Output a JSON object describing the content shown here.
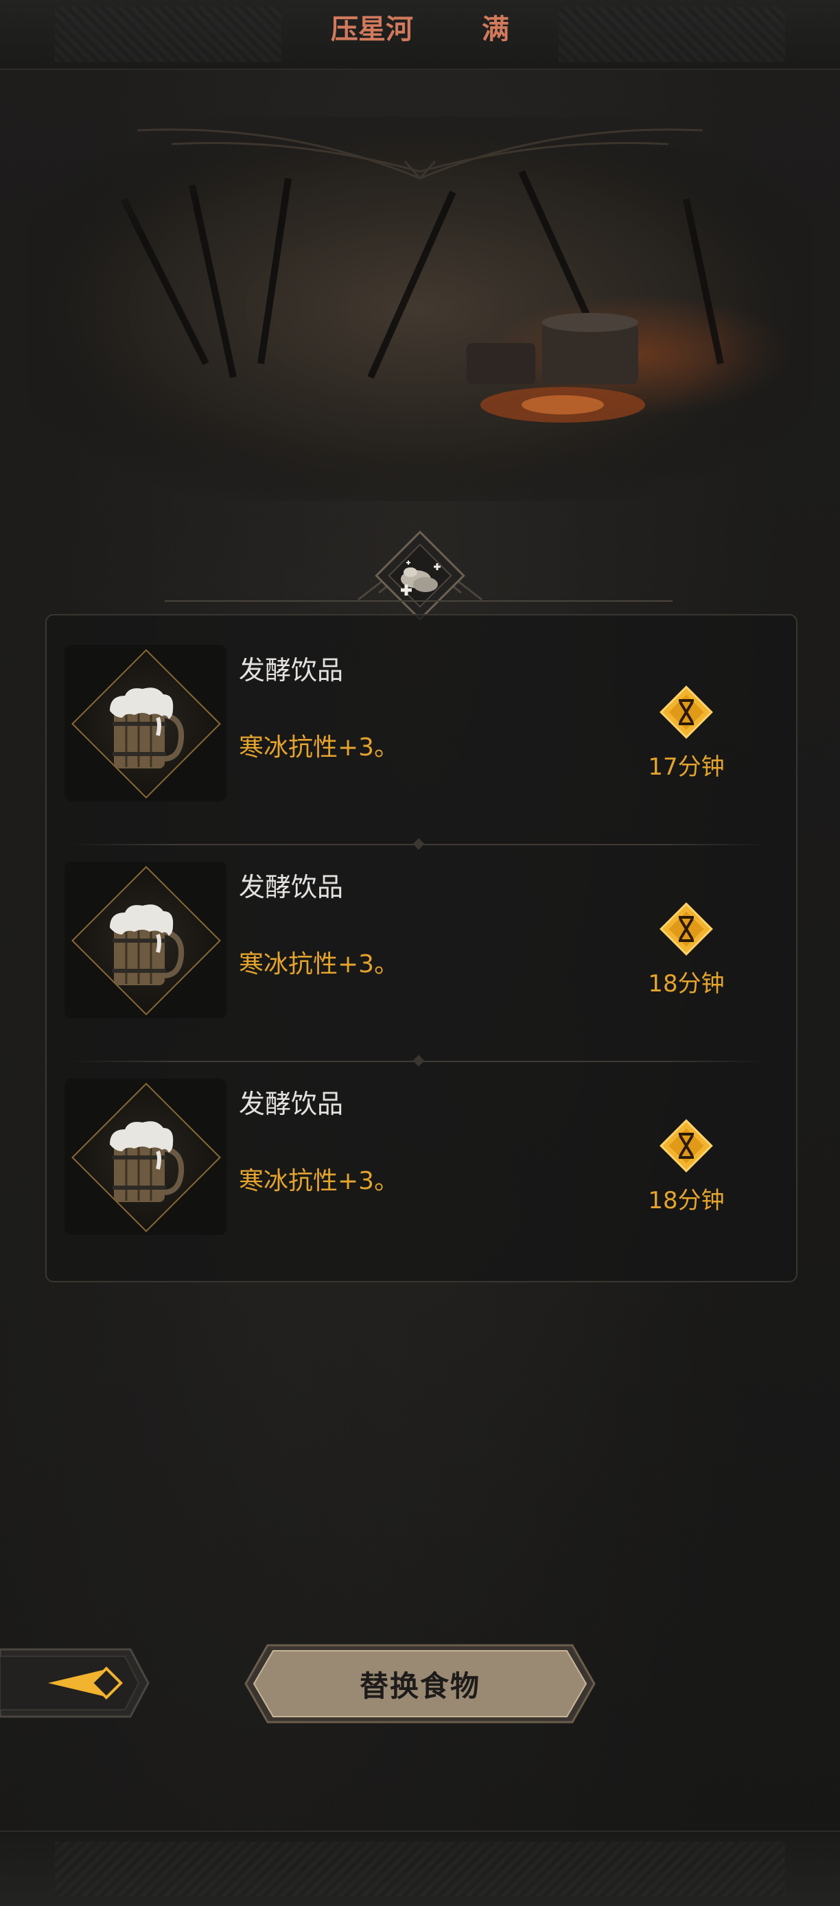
{
  "header": {
    "location": "压星河",
    "status": "满"
  },
  "emblem": {
    "icon": "food-ration-icon"
  },
  "food_list": [
    {
      "name": "发酵饮品",
      "effect": "寒冰抗性+3。",
      "duration": "17分钟",
      "icon": "beer-mug-icon"
    },
    {
      "name": "发酵饮品",
      "effect": "寒冰抗性+3。",
      "duration": "18分钟",
      "icon": "beer-mug-icon"
    },
    {
      "name": "发酵饮品",
      "effect": "寒冰抗性+3。",
      "duration": "18分钟",
      "icon": "beer-mug-icon"
    }
  ],
  "footer": {
    "replace_label": "替换食物",
    "back_icon": "back-arrow-icon"
  },
  "colors": {
    "accent": "#e5a42c",
    "title": "#d17a5c",
    "background": "#1b1b1a"
  }
}
